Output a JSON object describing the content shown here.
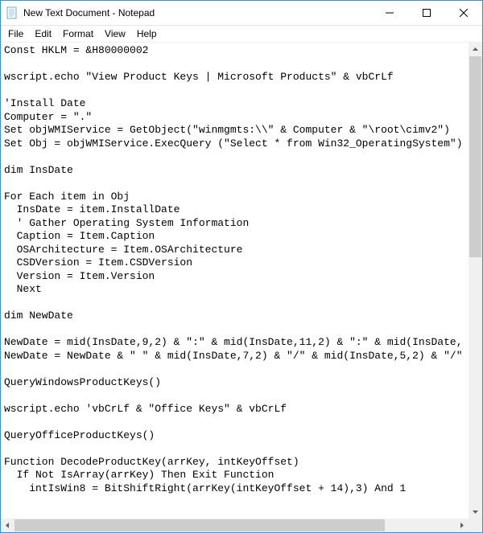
{
  "window": {
    "title": "New Text Document - Notepad"
  },
  "menu": {
    "file": "File",
    "edit": "Edit",
    "format": "Format",
    "view": "View",
    "help": "Help"
  },
  "editor": {
    "content": "Const HKLM = &H80000002\n\nwscript.echo \"View Product Keys | Microsoft Products\" & vbCrLf\n\n'Install Date\nComputer = \".\"\nSet objWMIService = GetObject(\"winmgmts:\\\\\" & Computer & \"\\root\\cimv2\")\nSet Obj = objWMIService.ExecQuery (\"Select * from Win32_OperatingSystem\")\n\ndim InsDate\n\nFor Each item in Obj\n  InsDate = item.InstallDate\n  ' Gather Operating System Information\n  Caption = Item.Caption\n  OSArchitecture = Item.OSArchitecture\n  CSDVersion = Item.CSDVersion\n  Version = Item.Version\n  Next\n\ndim NewDate\n\nNewDate = mid(InsDate,9,2) & \":\" & mid(InsDate,11,2) & \":\" & mid(InsDate,\nNewDate = NewDate & \" \" & mid(InsDate,7,2) & \"/\" & mid(InsDate,5,2) & \"/\"\n\nQueryWindowsProductKeys()\n\nwscript.echo 'vbCrLf & \"Office Keys\" & vbCrLf\n\nQueryOfficeProductKeys()\n\nFunction DecodeProductKey(arrKey, intKeyOffset)\n  If Not IsArray(arrKey) Then Exit Function\n    intIsWin8 = BitShiftRight(arrKey(intKeyOffset + 14),3) And 1"
  }
}
